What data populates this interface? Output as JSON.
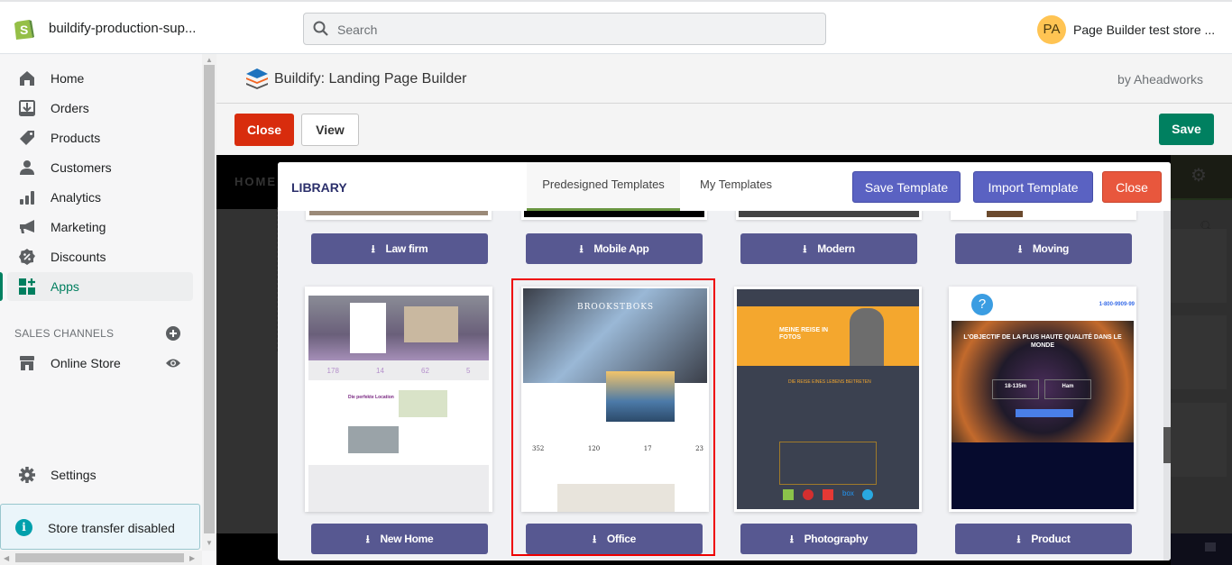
{
  "topbar": {
    "store_name": "buildify-production-sup...",
    "search_placeholder": "Search",
    "avatar_initials": "PA",
    "user_name": "Page Builder test store ..."
  },
  "sidebar": {
    "items": [
      {
        "label": "Home",
        "icon": "home-icon"
      },
      {
        "label": "Orders",
        "icon": "orders-icon"
      },
      {
        "label": "Products",
        "icon": "tag-icon"
      },
      {
        "label": "Customers",
        "icon": "person-icon"
      },
      {
        "label": "Analytics",
        "icon": "bar-chart-icon"
      },
      {
        "label": "Marketing",
        "icon": "megaphone-icon"
      },
      {
        "label": "Discounts",
        "icon": "discount-icon"
      },
      {
        "label": "Apps",
        "icon": "apps-icon",
        "active": true
      }
    ],
    "sales_channels_title": "SALES CHANNELS",
    "online_store": "Online Store",
    "settings": "Settings",
    "store_transfer": "Store transfer disabled"
  },
  "app": {
    "title": "Buildify: Landing Page Builder",
    "vendor": "by Aheadworks",
    "close_label": "Close",
    "view_label": "View",
    "save_label": "Save",
    "canvas_nav_home": "HOME"
  },
  "library": {
    "title": "LIBRARY",
    "tabs": [
      {
        "label": "Predesigned Templates",
        "active": true
      },
      {
        "label": "My Templates",
        "active": false
      }
    ],
    "save_template": "Save Template",
    "import_template": "Import Template",
    "close": "Close",
    "templates_row1": [
      "Law firm",
      "Mobile App",
      "Modern",
      "Moving"
    ],
    "templates_row2": [
      "New Home",
      "Office",
      "Photography",
      "Product"
    ],
    "selected_template": "Office",
    "previews": {
      "office_brand": "BROOKSTBOKS",
      "office_stats": [
        "352",
        "120",
        "17",
        "23"
      ],
      "newhome_stats": [
        "178",
        "14",
        "62",
        "5"
      ],
      "newhome_headline": "Die perfekte Location",
      "photo_headline": "MEINE REISE IN FOTOS",
      "photo_section": "DIE REISE EINES LEBENS BEITRETEN",
      "product_headline": "L'OBJECTIF DE LA PLUS HAUTE QUALITÉ DANS LE MONDE",
      "product_phone": "1-800-9909-99",
      "product_specs": [
        "18-135m",
        "Ham"
      ]
    }
  },
  "colors": {
    "accent_green": "#008060",
    "danger": "#d82c0d",
    "template_button": "#575891",
    "library_primary": "#5a62c2",
    "library_close": "#e8573d"
  }
}
